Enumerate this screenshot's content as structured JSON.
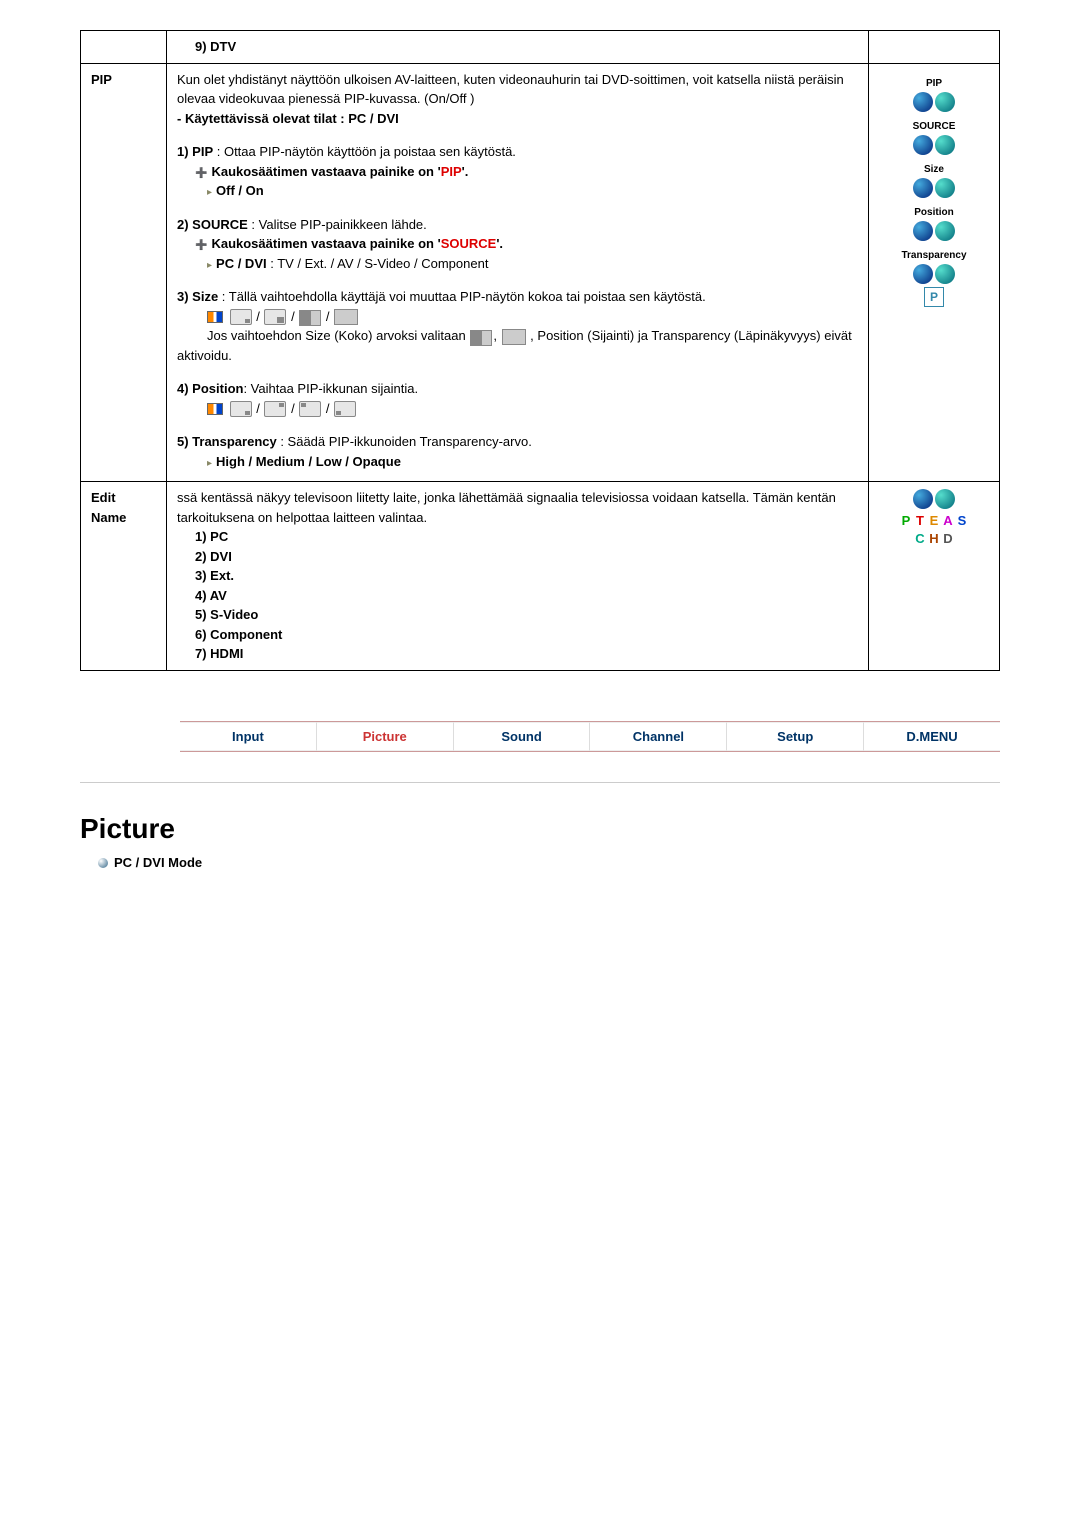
{
  "row0": {
    "item9": "9) DTV"
  },
  "pip": {
    "label": "PIP",
    "intro": "Kun olet yhdistänyt näyttöön ulkoisen AV-laitteen, kuten videonauhurin tai DVD-soittimen, voit katsella niistä peräisin olevaa videokuvaa pienessä PIP-kuvassa. (On/Off )",
    "modes": "- Käytettävissä olevat tilat : PC / DVI",
    "p1_a": "1) PIP",
    "p1_b": " : Ottaa PIP-näytön käyttöön ja poistaa sen käytöstä.",
    "p1_remote_a": "Kaukosäätimen vastaava painike on '",
    "p1_remote_key": "PIP",
    "p1_remote_b": "'.",
    "p1_opt": "Off / On",
    "p2_a": "2) SOURCE",
    "p2_b": " : Valitse PIP-painikkeen lähde.",
    "p2_remote_a": "Kaukosäätimen vastaava painike on '",
    "p2_remote_key": "SOURCE",
    "p2_remote_b": "'.",
    "p2_opt_a": "PC / DVI",
    "p2_opt_b": " : TV / Ext. / AV / S-Video / Component",
    "p3_a": "3) Size",
    "p3_b": " : Tällä vaihtoehdolla käyttäjä voi muuttaa PIP-näytön kokoa tai poistaa sen käytöstä.",
    "p3_note": "Jos vaihtoehdon Size (Koko) arvoksi valitaan ",
    "p3_note2": ", Position (Sijainti) ja Transparency  (Läpinäkyvyys) eivät aktivoidu.",
    "p4_a": "4) Position",
    "p4_b": ": Vaihtaa PIP-ikkunan sijaintia.",
    "p5_a": "5) Transparency",
    "p5_b": " : Säädä PIP-ikkunoiden Transparency-arvo.",
    "p5_opt": "High / Medium / Low / Opaque",
    "remote": {
      "pip": "PIP",
      "source": "SOURCE",
      "size": "Size",
      "position": "Position",
      "transparency": "Transparency",
      "p": "P"
    }
  },
  "edit": {
    "label1": "Edit",
    "label2": "Name",
    "intro": "ssä kentässä näkyy televisoon liitetty laite, jonka lähettämää signaalia televisiossa voidaan katsella. Tämän kentän tarkoituksena on helpottaa laitteen valintaa.",
    "i1": "1) PC",
    "i2": "2) DVI",
    "i3": "3) Ext.",
    "i4": "4) AV",
    "i5": "5) S-Video",
    "i6": "6) Component",
    "i7": "7) HDMI"
  },
  "tabs": {
    "t1": "Input",
    "t2": "Picture",
    "t3": "Sound",
    "t4": "Channel",
    "t5": "Setup",
    "t6": "D.MENU"
  },
  "section": {
    "title": "Picture",
    "sub": "PC / DVI Mode"
  }
}
